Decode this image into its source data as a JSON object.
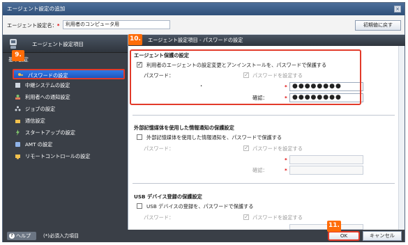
{
  "window": {
    "title": "エージェント設定の追加",
    "close_glyph": "×"
  },
  "namebar": {
    "label": "エージェント設定名：",
    "required_mark": "*",
    "value": "利用者のコンピュータ用",
    "reset_button": "初期値に戻す"
  },
  "callouts": {
    "c9": "9.",
    "c10": "10.",
    "c11": "11."
  },
  "sidebar": {
    "header": "エージェント設定項目",
    "category": "基本設定",
    "items": [
      {
        "label": "パスワードの設定",
        "icon": "key-icon",
        "active": true
      },
      {
        "label": "中継システムの設定",
        "icon": "relay-icon"
      },
      {
        "label": "利用者への通知設定",
        "icon": "notify-icon"
      },
      {
        "label": "ジョブの設定",
        "icon": "job-icon"
      },
      {
        "label": "通信設定",
        "icon": "network-icon"
      },
      {
        "label": "スタートアップの設定",
        "icon": "startup-icon"
      },
      {
        "label": "AMT の設定",
        "icon": "amt-icon"
      },
      {
        "label": "リモートコントロールの設定",
        "icon": "remote-icon"
      }
    ]
  },
  "main": {
    "header": "エージェント設定項目 - パスワードの設定",
    "agent_protect": {
      "title": "エージェント保護の設定",
      "checkbox_label": "利用者のエージェントの設定変更とアンインストールを、パスワードで保護する",
      "password_label": "パスワード：",
      "set_password_label": "パスワードを設定する",
      "confirm_label": "確認：",
      "password_value": "●●●●●●●●",
      "confirm_value": "●●●●●●●●",
      "dot": "・",
      "required_mark": "*"
    },
    "media_protect": {
      "title": "外部記憶媒体を使用した情報通知の保護設定",
      "checkbox_label": "外部記憶媒体を使用した情報通知を、パスワードで保護する",
      "password_label": "パスワード：",
      "set_password_label": "パスワードを設定する",
      "confirm_label": "確認：",
      "required_mark": "*"
    },
    "usb_protect": {
      "title": "USB デバイス登録の保護設定",
      "checkbox_label": "USB デバイスの登録を、パスワードで保護する",
      "password_label": "パスワード：",
      "set_password_label": "パスワードを設定する"
    }
  },
  "footer": {
    "help": "ヘルプ",
    "help_glyph": "?",
    "required_note": "(*)必須入力項目",
    "ok": "OK",
    "cancel": "キャンセル"
  }
}
